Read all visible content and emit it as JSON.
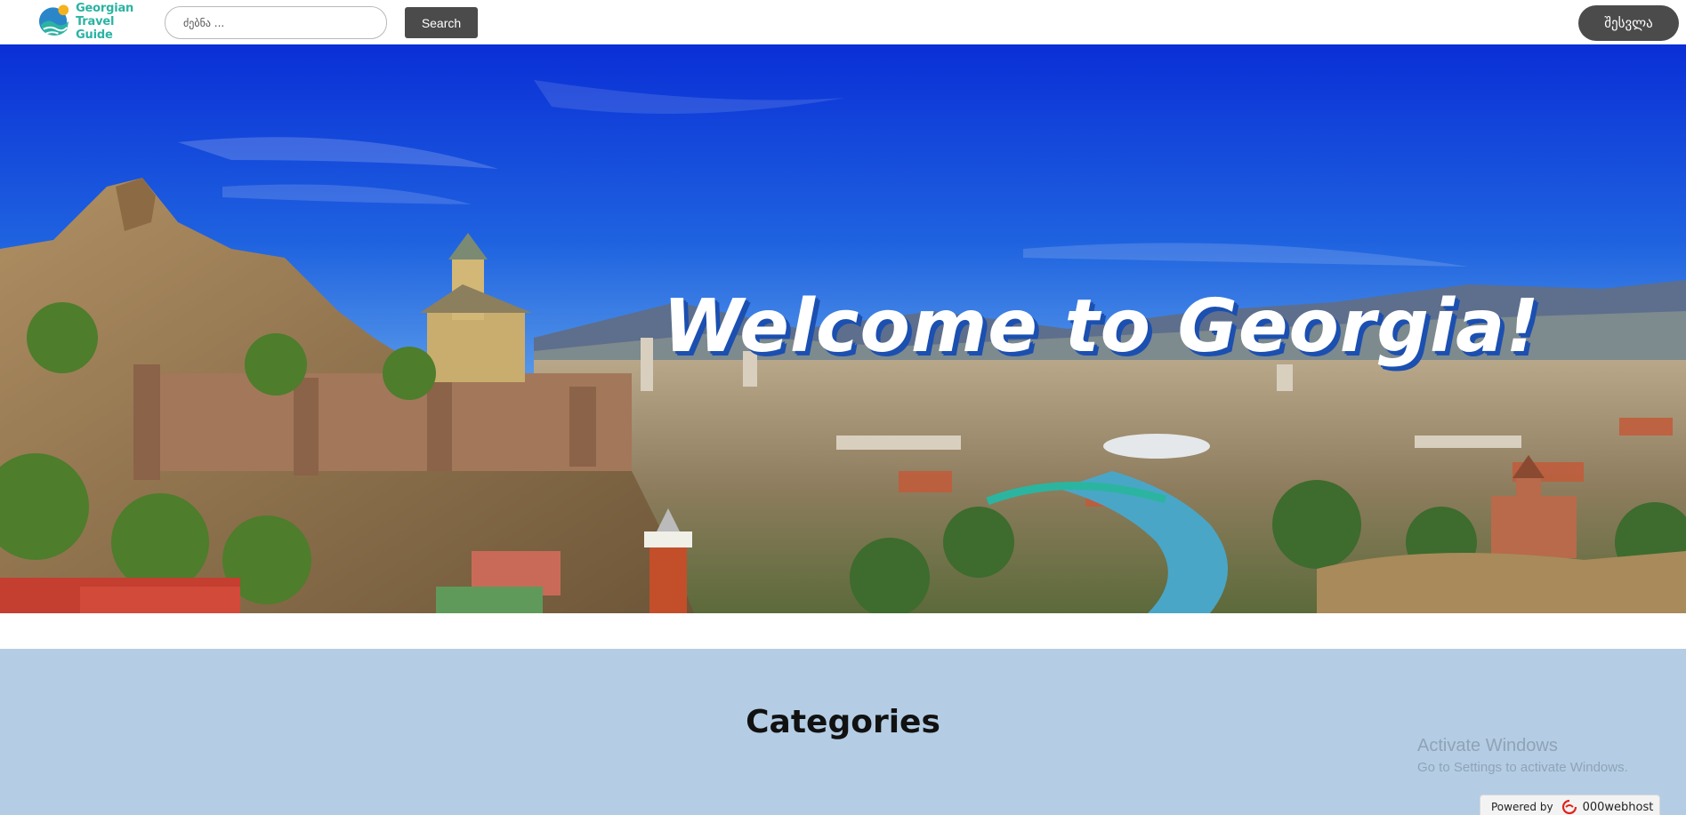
{
  "header": {
    "logo_line1": "Georgian",
    "logo_line2": "Travel Guide",
    "search_placeholder": "ძებნა ...",
    "search_button": "Search",
    "login_button": "შესვლა"
  },
  "hero": {
    "title": "Welcome to Georgia!"
  },
  "categories": {
    "title": "Categories"
  },
  "overlay": {
    "activate_title": "Activate Windows",
    "activate_subtitle": "Go to Settings to activate Windows.",
    "powered_by": "Powered by",
    "host_brand": "000webhost"
  },
  "colors": {
    "accent": "#2bb3a3",
    "button": "#4b4b4b",
    "categories_bg": "#b4cde4",
    "title_shadow": "#1b4fb0"
  }
}
